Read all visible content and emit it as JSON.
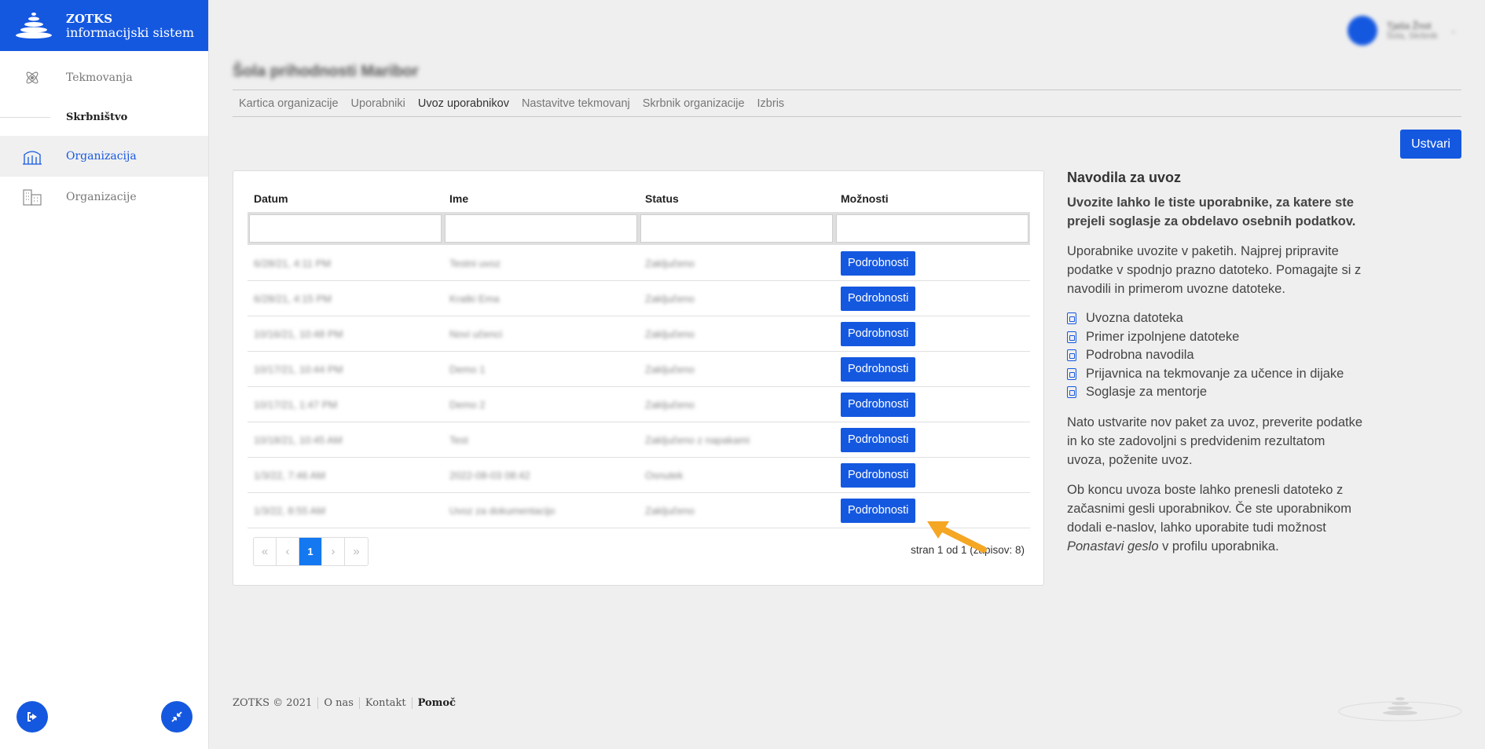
{
  "brand": {
    "line1": "ZOTKS",
    "line2": "informacijski sistem"
  },
  "sidebar": {
    "items": [
      {
        "label": "Tekmovanja",
        "icon": "atom-icon"
      },
      {
        "label": "Organizacija",
        "icon": "school-icon"
      },
      {
        "label": "Organizacije",
        "icon": "buildings-icon"
      }
    ],
    "section_label": "Skrbništvo",
    "logout_icon": "logout-icon",
    "collapse_icon": "collapse-icon"
  },
  "user": {
    "name": "Tjaša Žnot",
    "role": "Šola, Skrbnik"
  },
  "page": {
    "title": "Šola prihodnosti Maribor"
  },
  "tabs": [
    "Kartica organizacije",
    "Uporabniki",
    "Uvoz uporabnikov",
    "Nastavitve tekmovanj",
    "Skrbnik organizacije",
    "Izbris"
  ],
  "active_tab": "Uvoz uporabnikov",
  "create_button": "Ustvari",
  "table": {
    "headers": [
      "Datum",
      "Ime",
      "Status",
      "Možnosti"
    ],
    "rows": [
      {
        "date": "6/28/21, 4:11 PM",
        "name": "Testni uvoz",
        "status": "Zaključeno"
      },
      {
        "date": "6/28/21, 4:15 PM",
        "name": "Kratki Ema",
        "status": "Zaključeno"
      },
      {
        "date": "10/16/21, 10:48 PM",
        "name": "Novi učenci",
        "status": "Zaključeno"
      },
      {
        "date": "10/17/21, 10:44 PM",
        "name": "Demo 1",
        "status": "Zaključeno"
      },
      {
        "date": "10/17/21, 1:47 PM",
        "name": "Demo 2",
        "status": "Zaključeno"
      },
      {
        "date": "10/18/21, 10:45 AM",
        "name": "Test",
        "status": "Zaključeno z napakami"
      },
      {
        "date": "1/3/22, 7:46 AM",
        "name": "2022-08-03 08:42",
        "status": "Osnutek"
      },
      {
        "date": "1/3/22, 8:55 AM",
        "name": "Uvoz za dokumentacijo",
        "status": "Zaključeno"
      }
    ],
    "row_button": "Podrobnosti"
  },
  "pagination": {
    "first": "«",
    "prev": "‹",
    "current": "1",
    "next": "›",
    "last": "»",
    "info": "stran 1 od 1 (zapisov: 8)"
  },
  "instructions": {
    "title": "Navodila za uvoz",
    "bold_text": "Uvozite lahko le tiste uporabnike, za katere ste prejeli soglasje za obdelavo osebnih podatkov.",
    "p1": "Uporabnike uvozite v paketih. Najprej pripravite podatke v spodnjo prazno datoteko. Pomagajte si z navodili in primerom uvozne datoteke.",
    "links": [
      "Uvozna datoteka",
      "Primer izpolnjene datoteke",
      "Podrobna navodila",
      "Prijavnica na tekmovanje za učence in dijake",
      "Soglasje za mentorje"
    ],
    "p2": "Nato ustvarite nov paket za uvoz, preverite podatke in ko ste zadovoljni s predvidenim rezultatom uvoza, poženite uvoz.",
    "p3_a": "Ob koncu uvoza boste lahko prenesli datoteko z začasnimi gesli uporabnikov. Če ste uporabnikom dodali e-naslov, lahko uporabite tudi možnost ",
    "p3_em": "Ponastavi geslo",
    "p3_b": " v profilu uporabnika."
  },
  "footer": {
    "copy": "ZOTKS © 2021",
    "about": "O nas",
    "contact": "Kontakt",
    "help": "Pomoč"
  },
  "colors": {
    "accent": "#1558e0",
    "pager_active": "#1478f0",
    "arrow": "#f5a623"
  }
}
